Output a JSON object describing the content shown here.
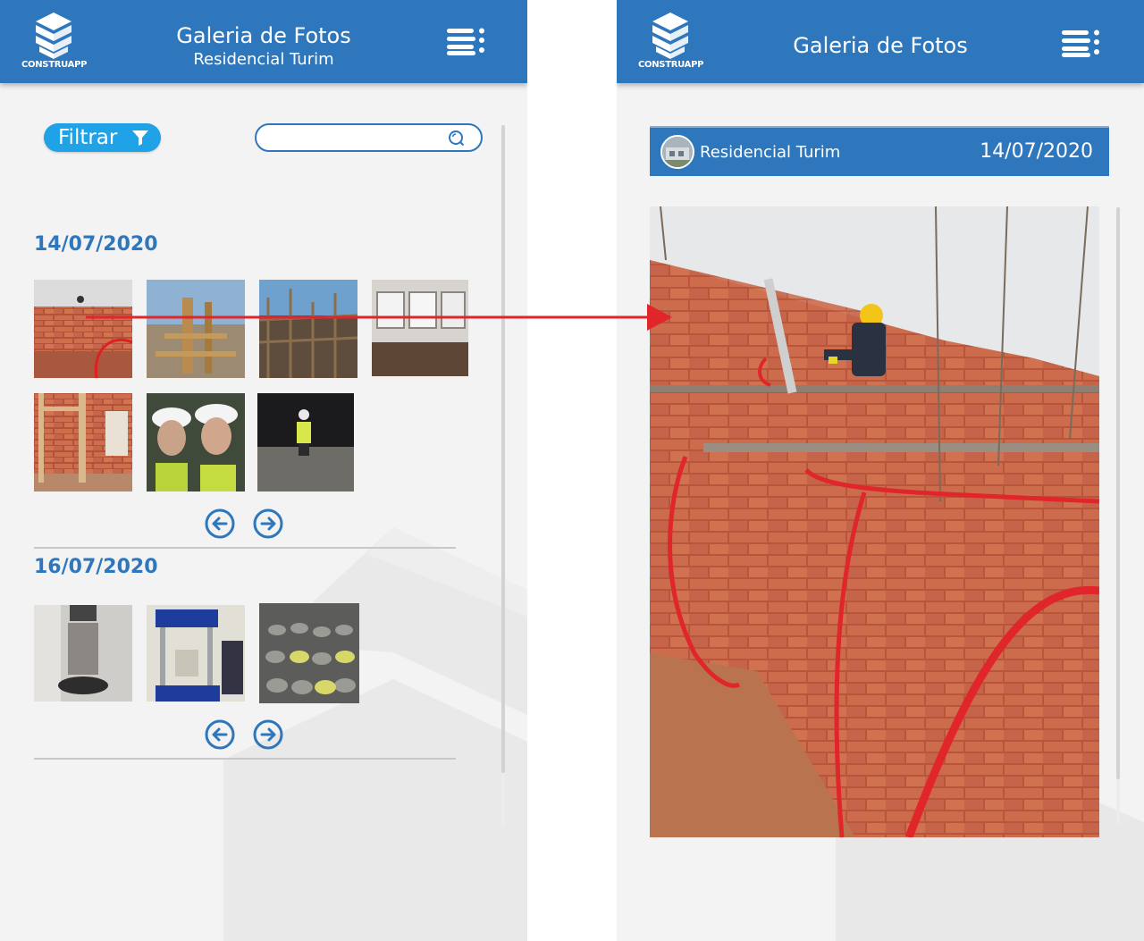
{
  "left_screen": {
    "header": {
      "logo_text": "CONSTRUAPP",
      "title": "Galeria de Fotos",
      "subtitle": "Residencial Turim",
      "menu_icon": "menu-icon"
    },
    "filter": {
      "label": "Filtrar",
      "icon": "filter-icon"
    },
    "search": {
      "value": "",
      "placeholder": "",
      "icon": "search-icon"
    },
    "groups": [
      {
        "date": "14/07/2020",
        "photos": [
          {
            "subject": "brick-walls-with-worker"
          },
          {
            "subject": "wood-formwork-scaffolding"
          },
          {
            "subject": "steel-rebar-frame"
          },
          {
            "subject": "interior-room-windows"
          },
          {
            "subject": "brick-walls-wood-frames"
          },
          {
            "subject": "two-workers-selfie-helmets"
          },
          {
            "subject": "worker-in-dark-hall"
          }
        ],
        "pager": {
          "prev_icon": "arrow-left-circle-icon",
          "next_icon": "arrow-right-circle-icon"
        }
      },
      {
        "date": "16/07/2020",
        "photos": [
          {
            "subject": "concrete-cylinder-press"
          },
          {
            "subject": "compression-test-machine"
          },
          {
            "subject": "concrete-specimens-curing"
          }
        ],
        "pager": {
          "prev_icon": "arrow-left-circle-icon",
          "next_icon": "arrow-right-circle-icon"
        }
      }
    ]
  },
  "right_screen": {
    "header": {
      "logo_text": "CONSTRUAPP",
      "title": "Galeria de Fotos",
      "menu_icon": "menu-icon"
    },
    "info_bar": {
      "project_name": "Residencial Turim",
      "date": "14/07/2020",
      "avatar_icon": "project-avatar"
    },
    "photo": {
      "subject": "brick-walls-with-worker-and-red-conduits"
    }
  },
  "annotation": {
    "arrow_color": "#e0262b"
  },
  "colors": {
    "primary": "#2e77bd",
    "accent": "#1fa3e6",
    "background": "#f3f3f3",
    "brick": "#c8603f"
  }
}
